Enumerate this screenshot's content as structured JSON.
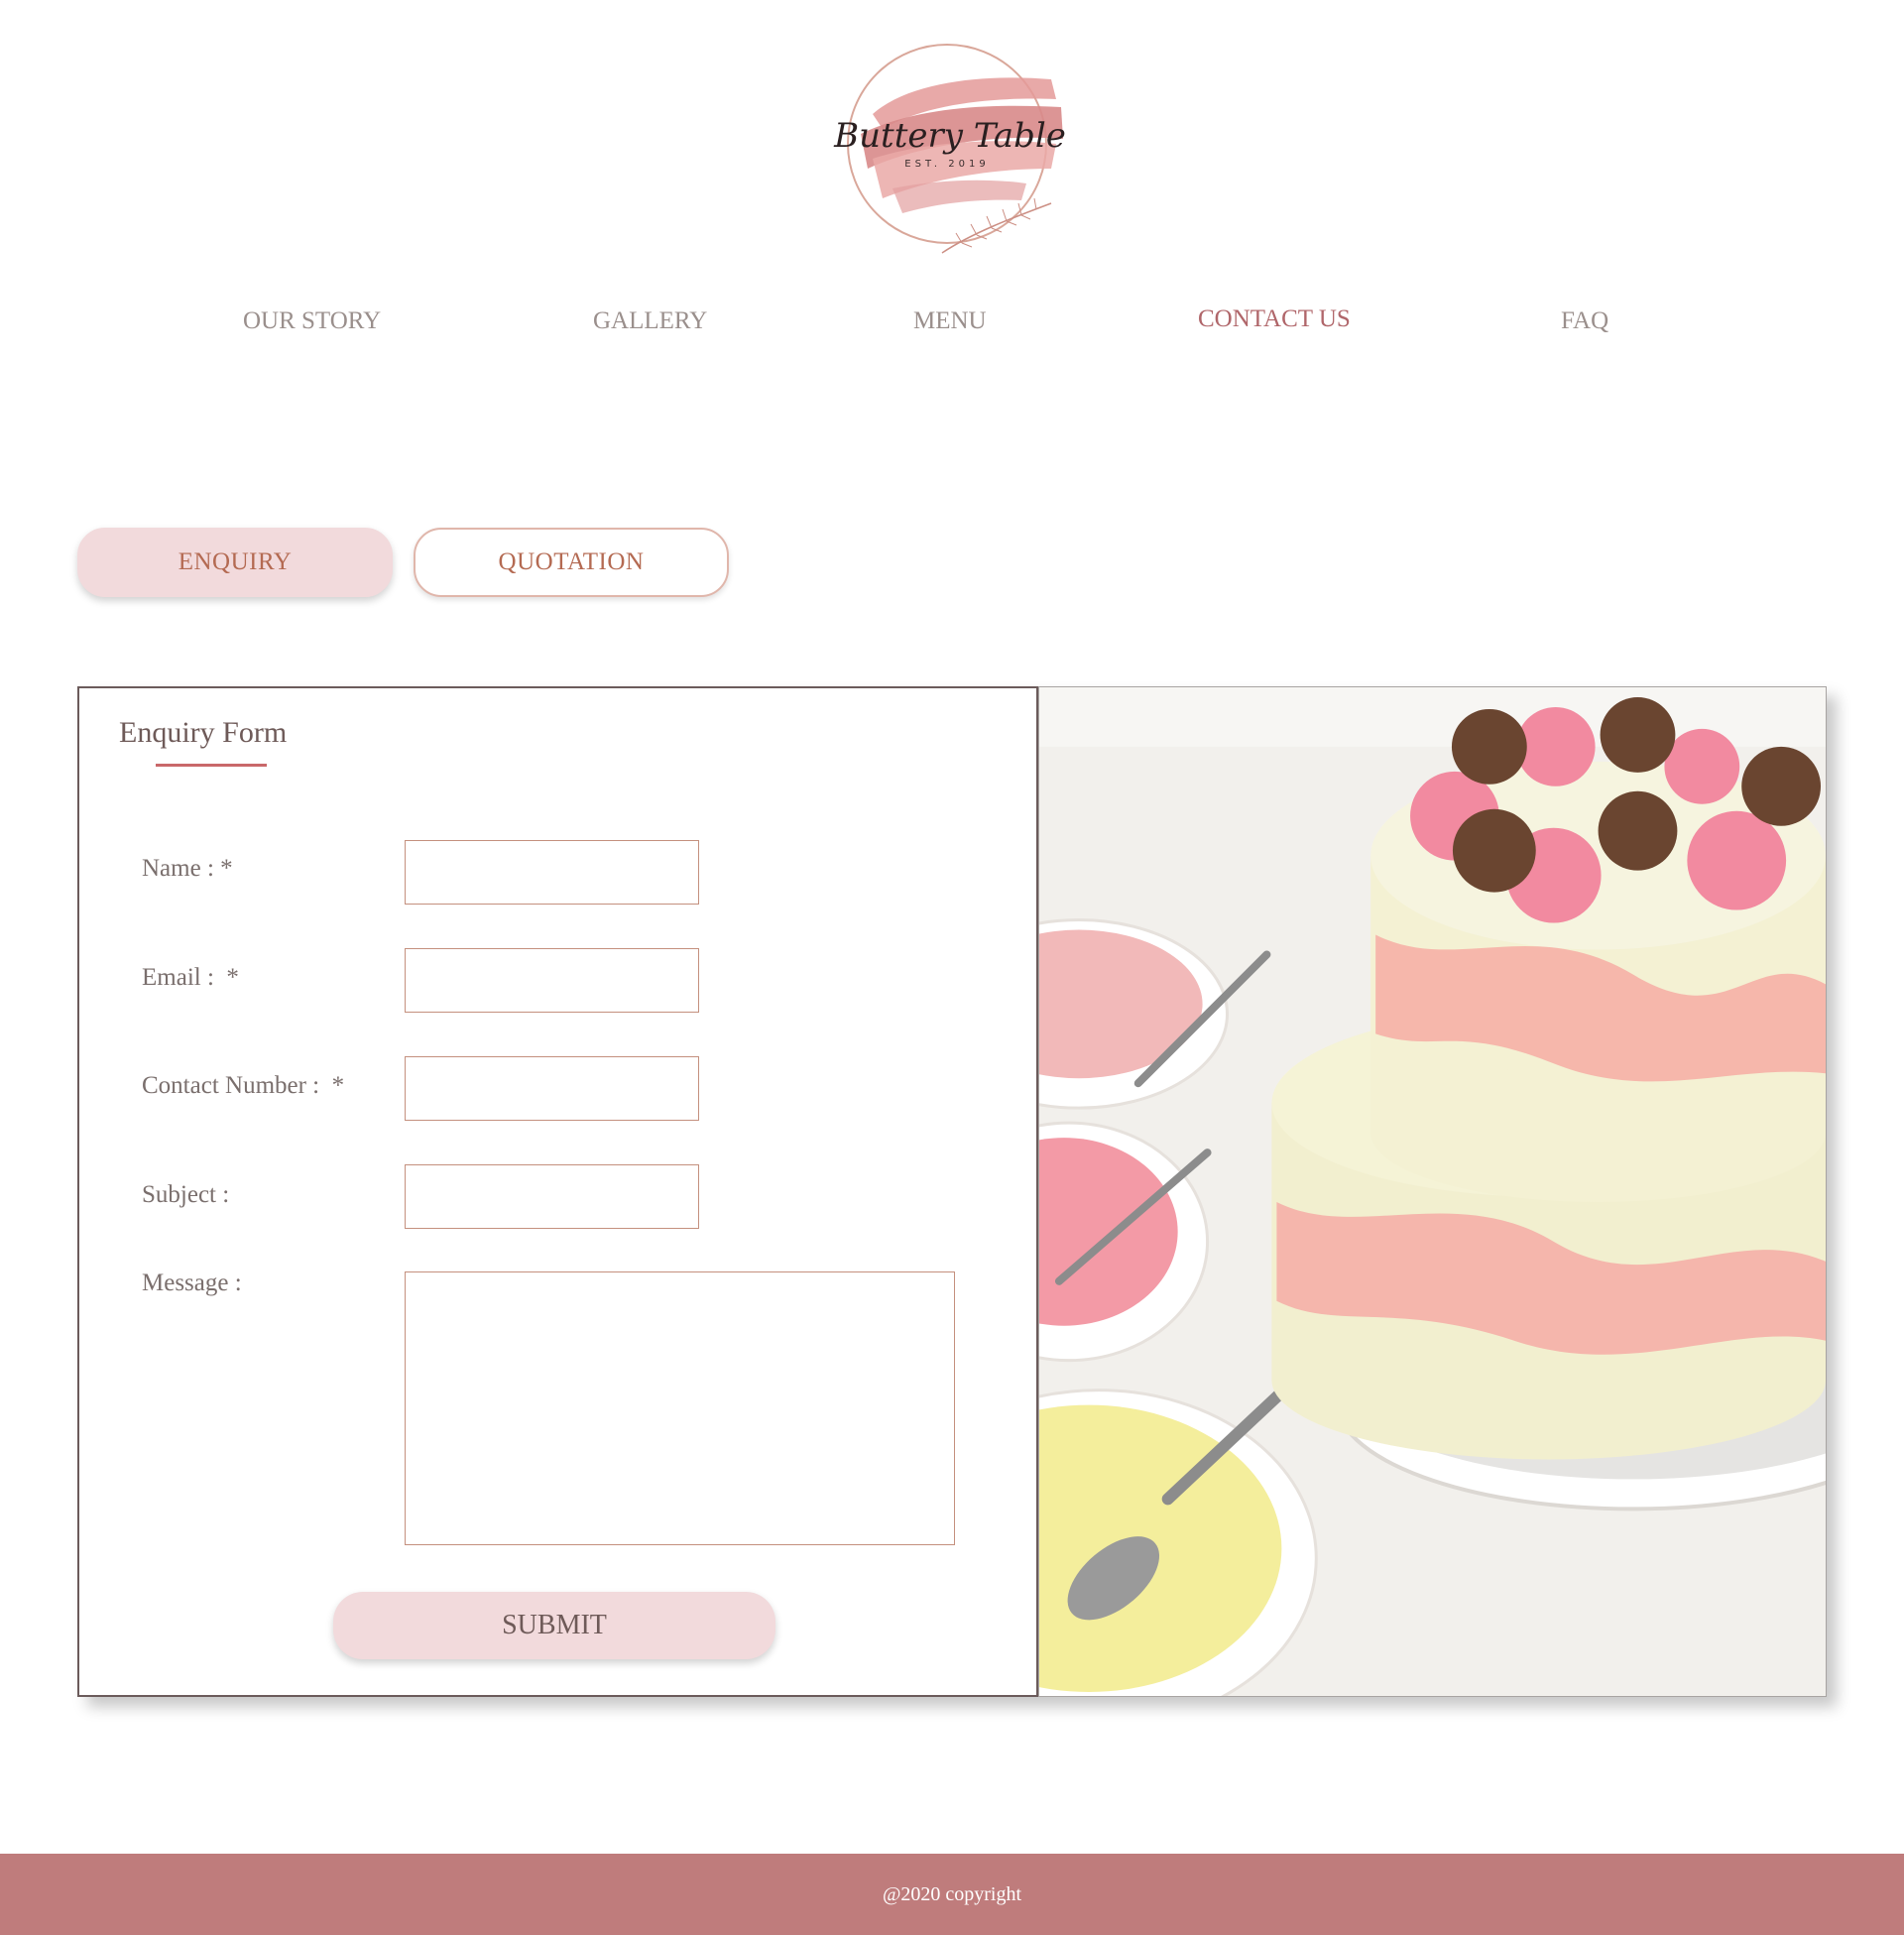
{
  "brand": {
    "name": "Buttery Table",
    "established": "EST. 2019"
  },
  "nav": {
    "items": [
      {
        "label": "OUR STORY"
      },
      {
        "label": "GALLERY"
      },
      {
        "label": "MENU"
      },
      {
        "label": "CONTACT US",
        "active": true
      },
      {
        "label": "FAQ"
      }
    ]
  },
  "tabs": {
    "enquiry": "ENQUIRY",
    "quotation": "QUOTATION",
    "selected": "ENQUIRY"
  },
  "form": {
    "title": "Enquiry Form",
    "fields": {
      "name": {
        "label": "Name : *",
        "value": ""
      },
      "email": {
        "label": "Email :  *",
        "value": ""
      },
      "contact": {
        "label": "Contact Number :  *",
        "value": ""
      },
      "subject": {
        "label": "Subject :",
        "value": ""
      },
      "message": {
        "label": "Message :",
        "value": ""
      }
    },
    "submit": "SUBMIT"
  },
  "photo": {
    "icon": "cake-photo"
  },
  "footer": {
    "copyright": "@2020 copyright"
  },
  "colors": {
    "accent": "#b0666a",
    "tab_fill": "#f2dadc",
    "tab_text": "#b46a52",
    "input_border": "#c4907e",
    "footer": "#bf7c7c"
  }
}
